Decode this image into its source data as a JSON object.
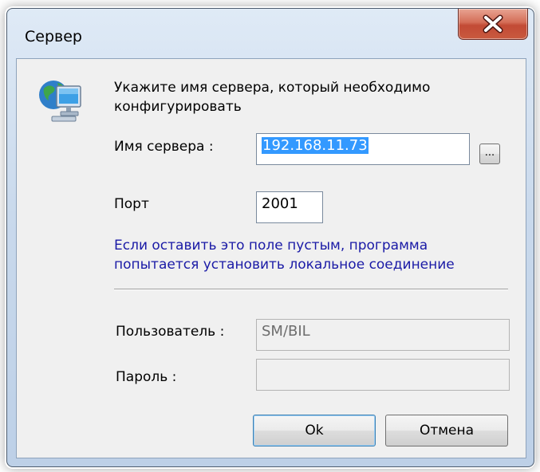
{
  "window": {
    "title": "Сервер"
  },
  "prompt": {
    "line1": "Укажите имя сервера, который необходимо",
    "line2": "конфигурировать"
  },
  "server": {
    "label": "Имя сервера :",
    "value": "192.168.11.73",
    "browse_label": "..."
  },
  "port": {
    "label": "Порт",
    "value": "2001"
  },
  "hint": {
    "line1": "Если оставить это поле пустым, программа",
    "line2": "попытается установить локальное соединение"
  },
  "user": {
    "label": "Пользователь :",
    "value": "SM/BIL"
  },
  "password": {
    "label": "Пароль :",
    "value": ""
  },
  "buttons": {
    "ok": "Ok",
    "cancel": "Отмена"
  },
  "icons": {
    "server": "network-computer-icon",
    "close": "close-icon"
  },
  "colors": {
    "hint_text": "#1a1aa6",
    "selection": "#3399ff",
    "close_button": "#c24a35"
  }
}
